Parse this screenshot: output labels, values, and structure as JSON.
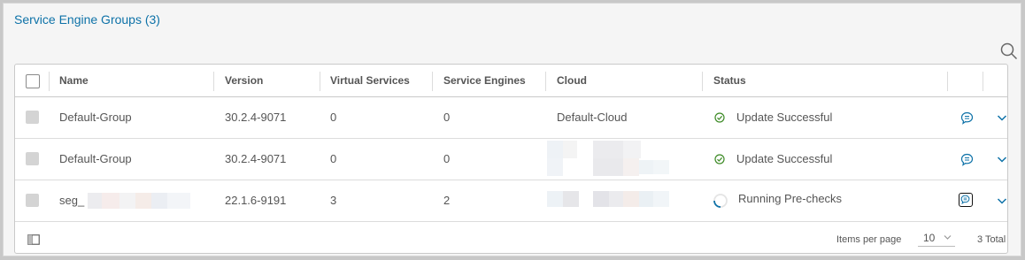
{
  "title": "Service Engine Groups (3)",
  "columns": [
    "Name",
    "Version",
    "Virtual Services",
    "Service Engines",
    "Cloud",
    "Status"
  ],
  "rows": [
    {
      "name": "Default-Group",
      "version": "30.2.4-9071",
      "virtual_services": "0",
      "service_engines": "0",
      "cloud": "Default-Cloud",
      "status": "Update Successful"
    },
    {
      "name": "Default-Group",
      "version": "30.2.4-9071",
      "virtual_services": "0",
      "service_engines": "0",
      "cloud": "",
      "status": "Update Successful"
    },
    {
      "name": "seg_",
      "version": "22.1.6-9191",
      "virtual_services": "3",
      "service_engines": "2",
      "cloud": "",
      "status": "Running Pre-checks"
    }
  ],
  "footer": {
    "items_per_page_label": "Items per page",
    "items_per_page_value": "10",
    "total": "3 Total"
  },
  "colors": {
    "accent": "#0e72a8",
    "success": "#3c8a25",
    "border": "#c9c9c9"
  },
  "icons": [
    "search-icon",
    "success-icon",
    "spinner-icon",
    "chat-icon",
    "chevron-down-icon",
    "column-toggle-icon"
  ]
}
